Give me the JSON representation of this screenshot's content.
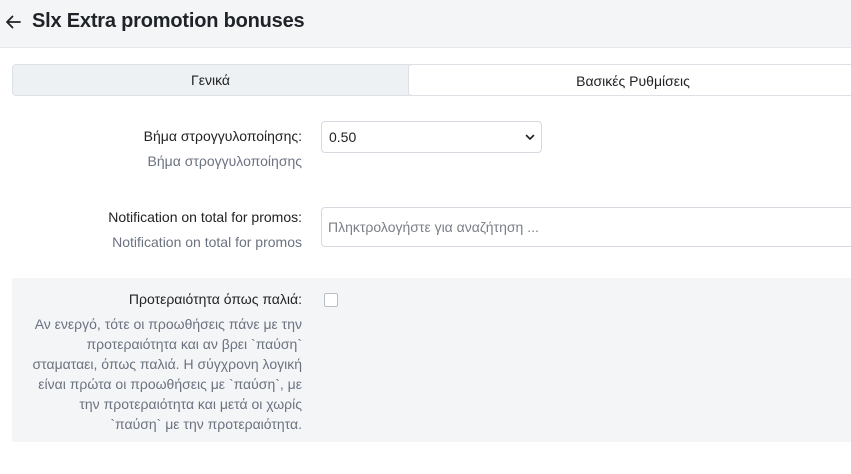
{
  "header": {
    "title": "Slx Extra promotion bonuses",
    "back_icon": "arrow-left-icon"
  },
  "tabs": [
    {
      "label": "Γενικά",
      "active": false
    },
    {
      "label": "Βασικές Ρυθμίσεις",
      "active": true
    }
  ],
  "settings": {
    "rounding": {
      "label": "Βήμα στρογγυλοποίησης:",
      "help": "Βήμα στρογγυλοποίησης",
      "value": "0.50",
      "icon": "chevron-down-icon"
    },
    "notification": {
      "label": "Notification on total for promos:",
      "help": "Notification on total for promos",
      "placeholder": "Πληκτρολογήστε για αναζήτηση ..."
    },
    "priority": {
      "label": "Προτεραιότητα όπως παλιά:",
      "checked": false,
      "help_lines": [
        "Αν ενεργό, τότε οι προωθήσεις πάνε με την",
        "προτεραιότητα και αν βρει `παύση`",
        "σταματαει, όπως παλιά. Η σύγχρονη λογική",
        "είναι πρώτα οι προωθήσεις με `παύση`, με",
        "την προτεραιότητα και μετά οι χωρίς",
        "`παύση` με την προτεραιότητα."
      ]
    }
  },
  "colors": {
    "header_bg": "#f4f5f7",
    "help_text": "#6b7280",
    "border": "#d6dae0"
  }
}
